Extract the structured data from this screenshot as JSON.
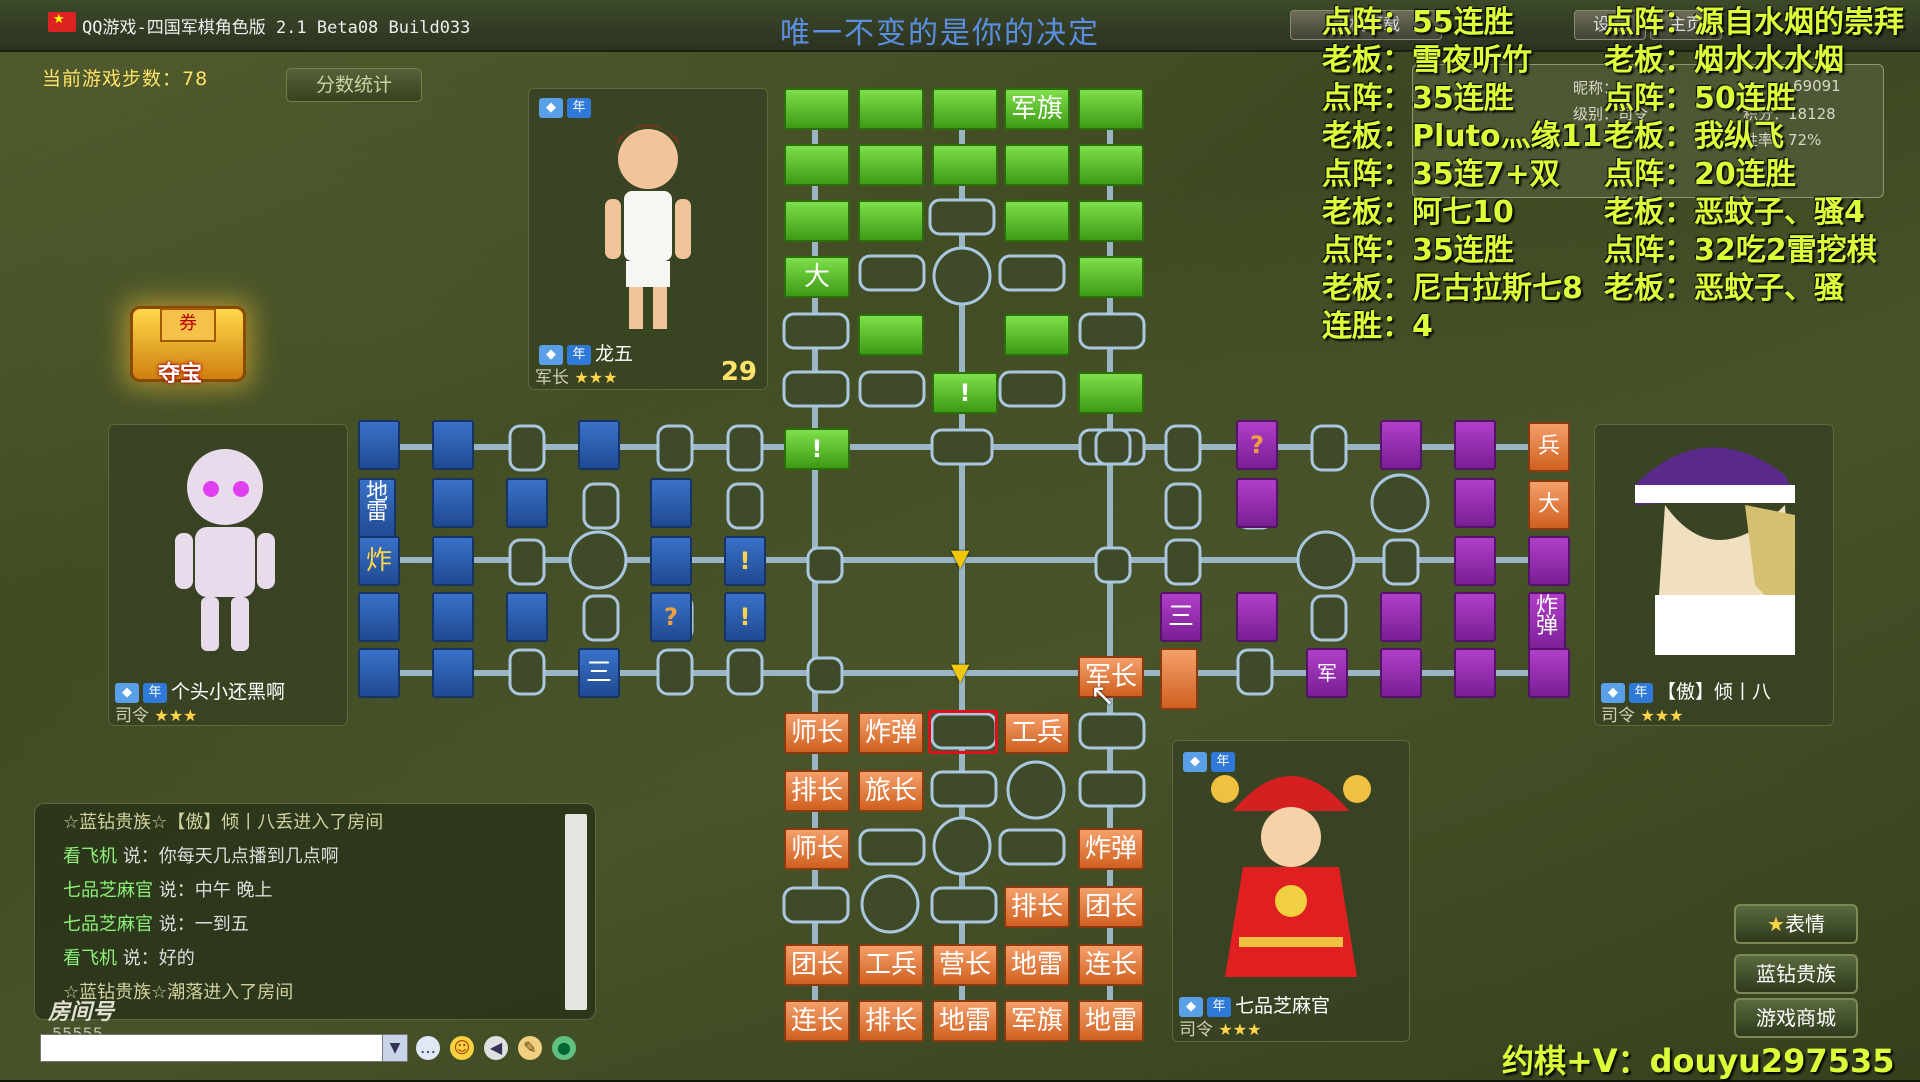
{
  "window": {
    "title": "QQ游戏-四国军棋角色版 2.1 Beta08 Build033",
    "slogan": "唯一不变的是你的决定",
    "buttons": [
      "手机下载",
      "设置",
      "主页"
    ]
  },
  "game": {
    "steps_label": "当前游戏步数：78",
    "score_button": "分数统计",
    "treasure_label": "夺宝",
    "treasure_ticket": "券"
  },
  "players": {
    "top": {
      "name": "龙五",
      "rank": "军长",
      "count": "29",
      "badge": "年"
    },
    "left": {
      "name": "个头小还黑啊",
      "rank": "司令",
      "badge": "年"
    },
    "right": {
      "name": "【傲】倾丨八",
      "rank": "司令",
      "badge": "年"
    },
    "bottom": {
      "name": "七品芝麻官",
      "rank": "司令",
      "badge": "年"
    }
  },
  "userinfo": {
    "nickname_label": "昵称：",
    "level_label": "级别：司令",
    "id_value": "69091",
    "points_value": "积分：18128",
    "rate_value": "胜率：72%"
  },
  "chat": {
    "lines": [
      {
        "who": "☆蓝钻贵族☆【傲】倾丨八",
        "text": "丢进入了房间",
        "sys": true
      },
      {
        "who": "看飞机",
        "text": "说：你每天几点播到几点啊",
        "sys": false
      },
      {
        "who": "七品芝麻官",
        "text": "说：中午 晚上",
        "sys": false
      },
      {
        "who": "七品芝麻官",
        "text": "说：一到五",
        "sys": false
      },
      {
        "who": "看飞机",
        "text": "说：好的",
        "sys": false
      },
      {
        "who": "☆蓝钻贵族☆潮落",
        "text": "进入了房间",
        "sys": true
      }
    ],
    "room_label": "房间号",
    "room_number": "55555"
  },
  "right_buttons": [
    "表情",
    "蓝钻贵族",
    "游戏商城"
  ],
  "overlay": {
    "left_col": [
      "点阵：55连胜",
      "老板：雪夜听竹",
      "点阵：35连胜",
      "老板：Pluto灬缘11",
      "点阵：35连7+双",
      "老板：阿七10",
      "点阵：35连胜",
      "老板：尼古拉斯七8",
      "连胜：4"
    ],
    "right_col": [
      "点阵：源自水烟的崇拜",
      "老板：烟水水水烟",
      "点阵：50连胜",
      "老板：我纵飞",
      "点阵：20连胜",
      "老板：恶蚊子、骚4",
      "点阵：32吃2雷挖棋",
      "老板：恶蚊子、骚"
    ],
    "contact": "约棋+V：douyu297535"
  },
  "board": {
    "green_labels": {
      "flag": "军旗",
      "big": "大",
      "alert": "!"
    },
    "orange_rows": [
      [
        "师长",
        "炸弹",
        "",
        "工兵",
        ""
      ],
      [
        "排长",
        "旅长",
        "",
        "",
        ""
      ],
      [
        "师长",
        "",
        "",
        "",
        "炸弹"
      ],
      [
        "",
        "",
        "",
        "排长",
        "团长"
      ],
      [
        "团长",
        "工兵",
        "营长",
        "地雷",
        "连长"
      ],
      [
        "连长",
        "排长",
        "地雷",
        "军旗",
        "地雷"
      ]
    ],
    "orange_extra": "军长",
    "purple_labels": {
      "unknown": "?",
      "soldier": "兵",
      "big": "大",
      "bomb": "炸弹",
      "army": "军",
      "camp": "三"
    },
    "blue_labels": {
      "bomb": "炸",
      "unknown": "?",
      "alert": "!",
      "mine": "地雷",
      "camp": "三"
    }
  },
  "colors": {
    "green_piece": "#56b82a",
    "orange_piece": "#e07a3a",
    "blue_piece": "#2a5aa8",
    "purple_piece": "#952ab0",
    "overlay_text": "#dcff3a"
  }
}
